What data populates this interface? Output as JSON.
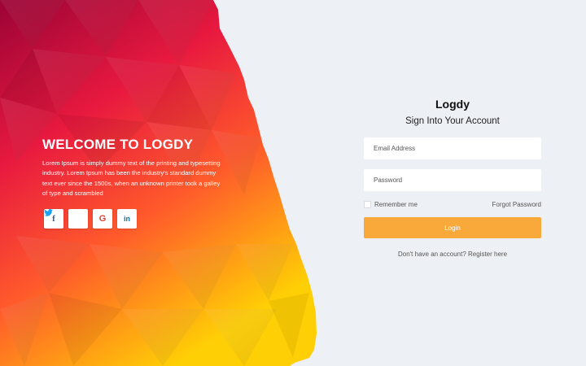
{
  "hero": {
    "title": "WELCOME TO LOGDY",
    "description": "Lorem Ipsum is simply dummy text of the printing and typesetting industry. Lorem Ipsum has been the industry's standard dummy text ever since the 1500s, when an unknown printer took a galley of type and scrambled",
    "socials": [
      {
        "name": "facebook",
        "glyph": "f",
        "color": "#3b5998"
      },
      {
        "name": "twitter",
        "glyph": "t",
        "color": "#1da1f2"
      },
      {
        "name": "google",
        "glyph": "G",
        "color": "#db4437"
      },
      {
        "name": "linkedin",
        "glyph": "in",
        "color": "#0e76a8"
      }
    ]
  },
  "form": {
    "brand": "Logdy",
    "subtitle": "Sign Into Your Account",
    "email_placeholder": "Email Address",
    "password_placeholder": "Password",
    "remember_label": "Remember me",
    "forgot_label": "Forgot Password",
    "login_label": "Login",
    "register_text": "Don't have an account? Register here"
  },
  "colors": {
    "background": "#edf0f5",
    "button": "#f9a93a",
    "gradient_top": "#a3053d",
    "gradient_mid": "#f73a3a",
    "gradient_bottom": "#ffd100"
  }
}
